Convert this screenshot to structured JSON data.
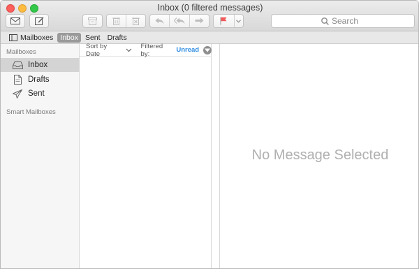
{
  "window": {
    "title": "Inbox (0 filtered messages)"
  },
  "toolbar": {
    "buttons": [
      {
        "name": "get-mail",
        "icon": "envelope-icon"
      },
      {
        "name": "compose",
        "icon": "compose-icon"
      },
      {
        "name": "archive",
        "icon": "archive-box-icon"
      },
      {
        "name": "delete",
        "icon": "trash-icon"
      },
      {
        "name": "junk",
        "icon": "junk-trash-icon"
      },
      {
        "name": "reply",
        "icon": "reply-icon"
      },
      {
        "name": "reply-all",
        "icon": "reply-all-icon"
      },
      {
        "name": "forward",
        "icon": "forward-icon"
      },
      {
        "name": "flag",
        "icon": "flag-icon"
      },
      {
        "name": "flag-menu",
        "icon": "chevron-down-icon"
      }
    ],
    "flag_color": "#f15b5b"
  },
  "search": {
    "placeholder": "Search"
  },
  "favorites": {
    "mailboxes_label": "Mailboxes",
    "items": [
      {
        "label": "Inbox",
        "active": true
      },
      {
        "label": "Sent",
        "active": false
      },
      {
        "label": "Drafts",
        "active": false
      }
    ]
  },
  "sidebar": {
    "section_mailboxes": "Mailboxes",
    "items": [
      {
        "label": "Inbox",
        "icon": "inbox-tray-icon",
        "selected": true
      },
      {
        "label": "Drafts",
        "icon": "document-icon",
        "selected": false
      },
      {
        "label": "Sent",
        "icon": "paper-plane-icon",
        "selected": false
      }
    ],
    "section_smart": "Smart Mailboxes"
  },
  "message_list": {
    "sort_label": "Sort by Date",
    "filter_label": "Filtered by:",
    "filter_value": "Unread",
    "filter_color": "#2f8ce2"
  },
  "preview": {
    "empty_text": "No Message Selected"
  }
}
